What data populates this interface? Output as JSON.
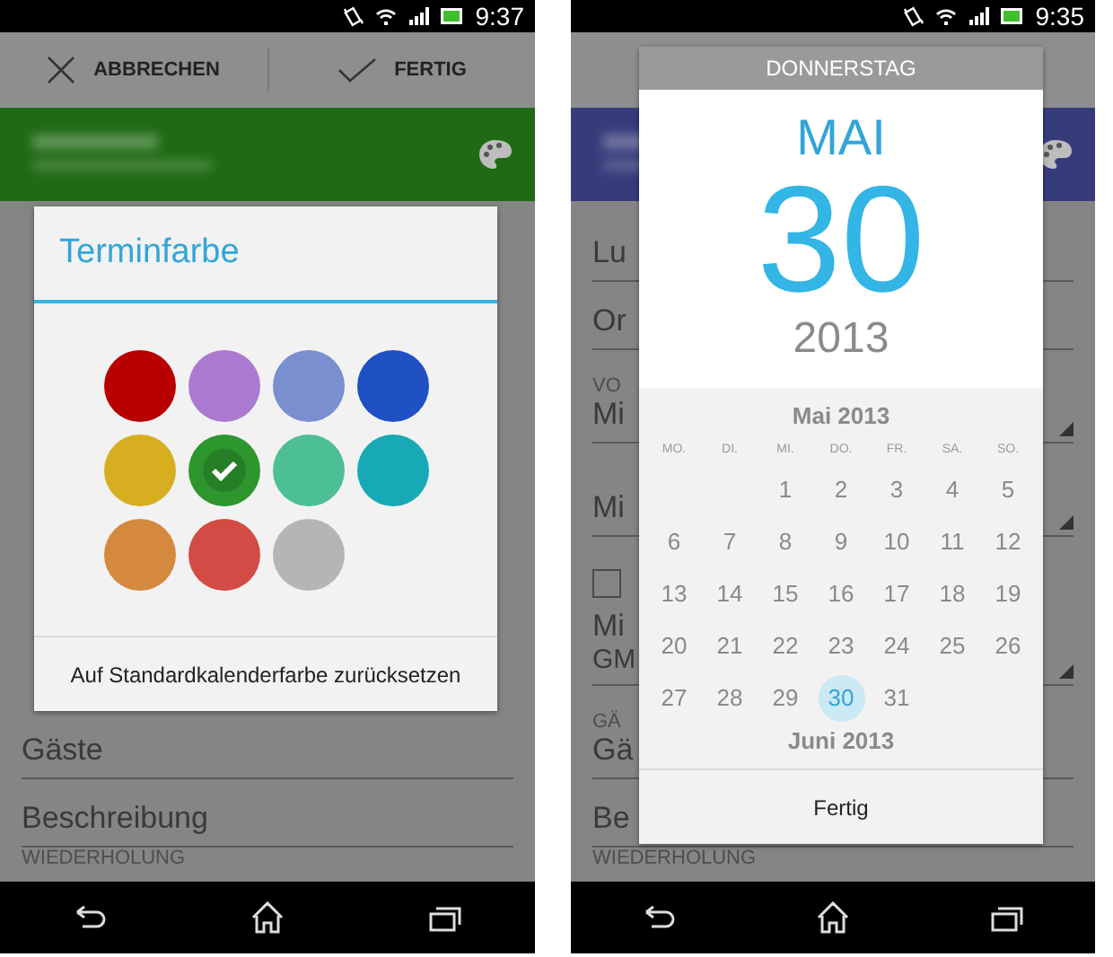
{
  "phones": [
    {
      "status": {
        "time": "9:37"
      },
      "action_bar": {
        "buttons": [
          {
            "label": "ABBRECHEN",
            "kind": "cancel"
          },
          {
            "label": "FERTIG",
            "kind": "done"
          }
        ]
      },
      "header": {
        "color": "#1f6a14"
      },
      "form": {
        "rows": [
          {
            "kind": "value",
            "text": "Gäste"
          },
          {
            "kind": "value",
            "text": "Beschreibung"
          },
          {
            "kind": "label",
            "text": "WIEDERHOLUNG"
          }
        ]
      },
      "dialog": {
        "kind": "color_picker",
        "title": "Terminfarbe",
        "action": "Auf Standardkalenderfarbe zurücksetzen",
        "swatches": [
          {
            "color": "#b80000",
            "selected": false
          },
          {
            "color": "#a97ad0",
            "selected": false
          },
          {
            "color": "#7a8fd0",
            "selected": false
          },
          {
            "color": "#1f50c4",
            "selected": false
          },
          {
            "color": "#d6ae20",
            "selected": false
          },
          {
            "color": "#2d962d",
            "selected": true
          },
          {
            "color": "#4dbf95",
            "selected": false
          },
          {
            "color": "#17a9b6",
            "selected": false
          },
          {
            "color": "#d5893f",
            "selected": false
          },
          {
            "color": "#d24c45",
            "selected": false
          },
          {
            "color": "#b5b5b5",
            "selected": false
          }
        ]
      }
    },
    {
      "status": {
        "time": "9:35"
      },
      "header": {
        "color": "#363c7a"
      },
      "form": {
        "rows": [
          {
            "kind": "value",
            "text": "Lu"
          },
          {
            "kind": "value",
            "text": "Or"
          },
          {
            "kind": "labeled",
            "label": "VO",
            "text": "Mi",
            "dropdown": true
          },
          {
            "kind": "spaced_value",
            "text": "Mi",
            "dropdown": true
          },
          {
            "kind": "checkbox",
            "checked": false
          },
          {
            "kind": "two_line",
            "text": "Mi",
            "subtext": "GM",
            "dropdown": true
          },
          {
            "kind": "labeled",
            "label": "GÄ",
            "text": "Gä"
          },
          {
            "kind": "value",
            "text": "Be"
          },
          {
            "kind": "label",
            "text": "WIEDERHOLUNG"
          }
        ]
      },
      "dialog": {
        "kind": "date_picker",
        "weekday": "DONNERSTAG",
        "month": "MAI",
        "day": "30",
        "year": "2013",
        "month_title": "Mai 2013",
        "next_month_title": "Juni 2013",
        "button": "Fertig",
        "weekdays": [
          "MO.",
          "DI.",
          "MI.",
          "DO.",
          "FR.",
          "SA.",
          "SO."
        ],
        "weeks": [
          {
            "kind": "first",
            "days": [
              {
                "label": "1",
                "selected": false
              },
              {
                "label": "2",
                "selected": false
              },
              {
                "label": "3",
                "selected": false
              },
              {
                "label": "4",
                "selected": false
              },
              {
                "label": "5",
                "selected": false
              }
            ]
          },
          {
            "kind": "full",
            "days": [
              {
                "label": "6",
                "selected": false
              },
              {
                "label": "7",
                "selected": false
              },
              {
                "label": "8",
                "selected": false
              },
              {
                "label": "9",
                "selected": false
              },
              {
                "label": "10",
                "selected": false
              },
              {
                "label": "11",
                "selected": false
              },
              {
                "label": "12",
                "selected": false
              }
            ]
          },
          {
            "kind": "full",
            "days": [
              {
                "label": "13",
                "selected": false
              },
              {
                "label": "14",
                "selected": false
              },
              {
                "label": "15",
                "selected": false
              },
              {
                "label": "16",
                "selected": false
              },
              {
                "label": "17",
                "selected": false
              },
              {
                "label": "18",
                "selected": false
              },
              {
                "label": "19",
                "selected": false
              }
            ]
          },
          {
            "kind": "full",
            "days": [
              {
                "label": "20",
                "selected": false
              },
              {
                "label": "21",
                "selected": false
              },
              {
                "label": "22",
                "selected": false
              },
              {
                "label": "23",
                "selected": false
              },
              {
                "label": "24",
                "selected": false
              },
              {
                "label": "25",
                "selected": false
              },
              {
                "label": "26",
                "selected": false
              }
            ]
          },
          {
            "kind": "last",
            "days": [
              {
                "label": "27",
                "selected": false
              },
              {
                "label": "28",
                "selected": false
              },
              {
                "label": "29",
                "selected": false
              },
              {
                "label": "30",
                "selected": true
              },
              {
                "label": "31",
                "selected": false
              }
            ]
          }
        ]
      }
    }
  ]
}
